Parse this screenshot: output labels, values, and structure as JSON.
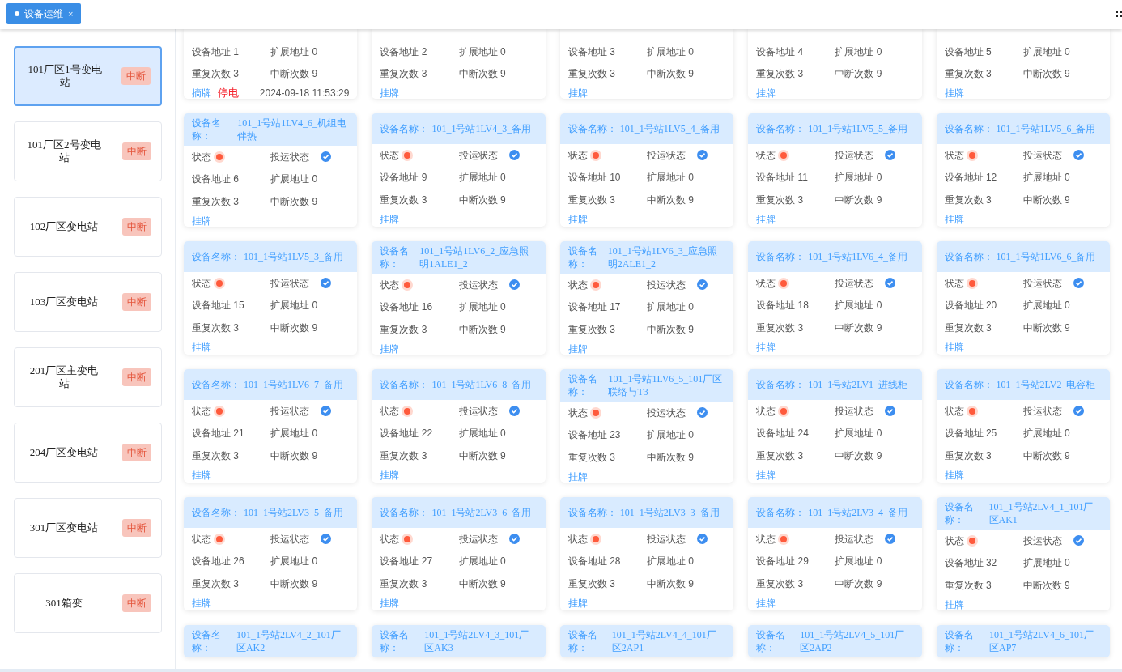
{
  "tabs": [
    {
      "label": "设备运维",
      "selected": true,
      "close": "×"
    }
  ],
  "stations": [
    {
      "name": "101厂区1号变电站",
      "badge": "中断",
      "selected": true
    },
    {
      "name": "101厂区2号变电站",
      "badge": "中断",
      "selected": false
    },
    {
      "name": "102厂区变电站",
      "badge": "中断",
      "selected": false
    },
    {
      "name": "103厂区变电站",
      "badge": "中断",
      "selected": false
    },
    {
      "name": "201厂区主变电站",
      "badge": "中断",
      "selected": false
    },
    {
      "name": "204厂区变电站",
      "badge": "中断",
      "selected": false
    },
    {
      "name": "301厂区变电站",
      "badge": "中断",
      "selected": false
    },
    {
      "name": "301箱变",
      "badge": "中断",
      "selected": false
    }
  ],
  "devices": [
    {
      "kind": "partial-top",
      "address": "设备地址 1",
      "ext": "扩展地址 0",
      "repeat": "重复次数 3",
      "breaks": "中断次数 9",
      "actions": [
        {
          "kind": "link",
          "text": "摘牌"
        },
        {
          "kind": "alert",
          "text": "停电"
        },
        {
          "kind": "time",
          "text": "2024-09-18 11:53:29"
        }
      ]
    },
    {
      "kind": "partial-top",
      "address": "设备地址 2",
      "ext": "扩展地址 0",
      "repeat": "重复次数 3",
      "breaks": "中断次数 9",
      "actions": [
        {
          "kind": "link",
          "text": "挂牌"
        }
      ]
    },
    {
      "kind": "partial-top",
      "address": "设备地址 3",
      "ext": "扩展地址 0",
      "repeat": "重复次数 3",
      "breaks": "中断次数 9",
      "actions": [
        {
          "kind": "link",
          "text": "挂牌"
        }
      ]
    },
    {
      "kind": "partial-top",
      "address": "设备地址 4",
      "ext": "扩展地址 0",
      "repeat": "重复次数 3",
      "breaks": "中断次数 9",
      "actions": [
        {
          "kind": "link",
          "text": "挂牌"
        }
      ]
    },
    {
      "kind": "partial-top",
      "address": "设备地址 5",
      "ext": "扩展地址 0",
      "repeat": "重复次数 3",
      "breaks": "中断次数 9",
      "actions": [
        {
          "kind": "link",
          "text": "挂牌"
        }
      ]
    },
    {
      "kind": "full",
      "name_label": "设备名称：",
      "name": "101_1号站1LV4_6_机组电伴热",
      "status_label": "状态",
      "alarm": true,
      "run_label": "投运状态",
      "in_service": true,
      "address": "设备地址 6",
      "ext": "扩展地址 0",
      "repeat": "重复次数 3",
      "breaks": "中断次数 9",
      "actions": [
        {
          "kind": "link",
          "text": "挂牌"
        }
      ]
    },
    {
      "kind": "full",
      "name_label": "设备名称：",
      "name": "101_1号站1LV4_3_备用",
      "status_label": "状态",
      "alarm": true,
      "run_label": "投运状态",
      "in_service": true,
      "address": "设备地址 9",
      "ext": "扩展地址 0",
      "repeat": "重复次数 3",
      "breaks": "中断次数 9",
      "actions": [
        {
          "kind": "link",
          "text": "挂牌"
        }
      ]
    },
    {
      "kind": "full",
      "name_label": "设备名称：",
      "name": "101_1号站1LV5_4_备用",
      "status_label": "状态",
      "alarm": true,
      "run_label": "投运状态",
      "in_service": true,
      "address": "设备地址 10",
      "ext": "扩展地址 0",
      "repeat": "重复次数 3",
      "breaks": "中断次数 9",
      "actions": [
        {
          "kind": "link",
          "text": "挂牌"
        }
      ]
    },
    {
      "kind": "full",
      "name_label": "设备名称：",
      "name": "101_1号站1LV5_5_备用",
      "status_label": "状态",
      "alarm": true,
      "run_label": "投运状态",
      "in_service": true,
      "address": "设备地址 11",
      "ext": "扩展地址 0",
      "repeat": "重复次数 3",
      "breaks": "中断次数 9",
      "actions": [
        {
          "kind": "link",
          "text": "挂牌"
        }
      ]
    },
    {
      "kind": "full",
      "name_label": "设备名称：",
      "name": "101_1号站1LV5_6_备用",
      "status_label": "状态",
      "alarm": true,
      "run_label": "投运状态",
      "in_service": true,
      "address": "设备地址 12",
      "ext": "扩展地址 0",
      "repeat": "重复次数 3",
      "breaks": "中断次数 9",
      "actions": [
        {
          "kind": "link",
          "text": "挂牌"
        }
      ]
    },
    {
      "kind": "full",
      "name_label": "设备名称：",
      "name": "101_1号站1LV5_3_备用",
      "status_label": "状态",
      "alarm": true,
      "run_label": "投运状态",
      "in_service": true,
      "address": "设备地址 15",
      "ext": "扩展地址 0",
      "repeat": "重复次数 3",
      "breaks": "中断次数 9",
      "actions": [
        {
          "kind": "link",
          "text": "挂牌"
        }
      ]
    },
    {
      "kind": "full",
      "name_label": "设备名称：",
      "name": "101_1号站1LV6_2_应急照明1ALE1_2",
      "status_label": "状态",
      "alarm": true,
      "run_label": "投运状态",
      "in_service": true,
      "address": "设备地址 16",
      "ext": "扩展地址 0",
      "repeat": "重复次数 3",
      "breaks": "中断次数 9",
      "actions": [
        {
          "kind": "link",
          "text": "挂牌"
        }
      ]
    },
    {
      "kind": "full",
      "name_label": "设备名称：",
      "name": "101_1号站1LV6_3_应急照明2ALE1_2",
      "status_label": "状态",
      "alarm": true,
      "run_label": "投运状态",
      "in_service": true,
      "address": "设备地址 17",
      "ext": "扩展地址 0",
      "repeat": "重复次数 3",
      "breaks": "中断次数 9",
      "actions": [
        {
          "kind": "link",
          "text": "挂牌"
        }
      ]
    },
    {
      "kind": "full",
      "name_label": "设备名称：",
      "name": "101_1号站1LV6_4_备用",
      "status_label": "状态",
      "alarm": true,
      "run_label": "投运状态",
      "in_service": true,
      "address": "设备地址 18",
      "ext": "扩展地址 0",
      "repeat": "重复次数 3",
      "breaks": "中断次数 9",
      "actions": [
        {
          "kind": "link",
          "text": "挂牌"
        }
      ]
    },
    {
      "kind": "full",
      "name_label": "设备名称：",
      "name": "101_1号站1LV6_6_备用",
      "status_label": "状态",
      "alarm": true,
      "run_label": "投运状态",
      "in_service": true,
      "address": "设备地址 20",
      "ext": "扩展地址 0",
      "repeat": "重复次数 3",
      "breaks": "中断次数 9",
      "actions": [
        {
          "kind": "link",
          "text": "挂牌"
        }
      ]
    },
    {
      "kind": "full",
      "name_label": "设备名称：",
      "name": "101_1号站1LV6_7_备用",
      "status_label": "状态",
      "alarm": true,
      "run_label": "投运状态",
      "in_service": true,
      "address": "设备地址 21",
      "ext": "扩展地址 0",
      "repeat": "重复次数 3",
      "breaks": "中断次数 9",
      "actions": [
        {
          "kind": "link",
          "text": "挂牌"
        }
      ]
    },
    {
      "kind": "full",
      "name_label": "设备名称：",
      "name": "101_1号站1LV6_8_备用",
      "status_label": "状态",
      "alarm": true,
      "run_label": "投运状态",
      "in_service": true,
      "address": "设备地址 22",
      "ext": "扩展地址 0",
      "repeat": "重复次数 3",
      "breaks": "中断次数 9",
      "actions": [
        {
          "kind": "link",
          "text": "挂牌"
        }
      ]
    },
    {
      "kind": "full",
      "name_label": "设备名称：",
      "name": "101_1号站1LV6_5_101厂区联络与T3",
      "status_label": "状态",
      "alarm": true,
      "run_label": "投运状态",
      "in_service": true,
      "address": "设备地址 23",
      "ext": "扩展地址 0",
      "repeat": "重复次数 3",
      "breaks": "中断次数 9",
      "actions": [
        {
          "kind": "link",
          "text": "挂牌"
        }
      ]
    },
    {
      "kind": "full",
      "name_label": "设备名称：",
      "name": "101_1号站2LV1_进线柜",
      "status_label": "状态",
      "alarm": true,
      "run_label": "投运状态",
      "in_service": true,
      "address": "设备地址 24",
      "ext": "扩展地址 0",
      "repeat": "重复次数 3",
      "breaks": "中断次数 9",
      "actions": [
        {
          "kind": "link",
          "text": "挂牌"
        }
      ]
    },
    {
      "kind": "full",
      "name_label": "设备名称：",
      "name": "101_1号站2LV2_电容柜",
      "status_label": "状态",
      "alarm": true,
      "run_label": "投运状态",
      "in_service": true,
      "address": "设备地址 25",
      "ext": "扩展地址 0",
      "repeat": "重复次数 3",
      "breaks": "中断次数 9",
      "actions": [
        {
          "kind": "link",
          "text": "挂牌"
        }
      ]
    },
    {
      "kind": "full",
      "name_label": "设备名称：",
      "name": "101_1号站2LV3_5_备用",
      "status_label": "状态",
      "alarm": true,
      "run_label": "投运状态",
      "in_service": true,
      "address": "设备地址 26",
      "ext": "扩展地址 0",
      "repeat": "重复次数 3",
      "breaks": "中断次数 9",
      "actions": [
        {
          "kind": "link",
          "text": "挂牌"
        }
      ]
    },
    {
      "kind": "full",
      "name_label": "设备名称：",
      "name": "101_1号站2LV3_6_备用",
      "status_label": "状态",
      "alarm": true,
      "run_label": "投运状态",
      "in_service": true,
      "address": "设备地址 27",
      "ext": "扩展地址 0",
      "repeat": "重复次数 3",
      "breaks": "中断次数 9",
      "actions": [
        {
          "kind": "link",
          "text": "挂牌"
        }
      ]
    },
    {
      "kind": "full",
      "name_label": "设备名称：",
      "name": "101_1号站2LV3_3_备用",
      "status_label": "状态",
      "alarm": true,
      "run_label": "投运状态",
      "in_service": true,
      "address": "设备地址 28",
      "ext": "扩展地址 0",
      "repeat": "重复次数 3",
      "breaks": "中断次数 9",
      "actions": [
        {
          "kind": "link",
          "text": "挂牌"
        }
      ]
    },
    {
      "kind": "full",
      "name_label": "设备名称：",
      "name": "101_1号站2LV3_4_备用",
      "status_label": "状态",
      "alarm": true,
      "run_label": "投运状态",
      "in_service": true,
      "address": "设备地址 29",
      "ext": "扩展地址 0",
      "repeat": "重复次数 3",
      "breaks": "中断次数 9",
      "actions": [
        {
          "kind": "link",
          "text": "挂牌"
        }
      ]
    },
    {
      "kind": "full",
      "name_label": "设备名称：",
      "name": "101_1号站2LV4_1_101厂区AK1",
      "status_label": "状态",
      "alarm": true,
      "run_label": "投运状态",
      "in_service": true,
      "address": "设备地址 32",
      "ext": "扩展地址 0",
      "repeat": "重复次数 3",
      "breaks": "中断次数 9",
      "actions": [
        {
          "kind": "link",
          "text": "挂牌"
        }
      ]
    },
    {
      "kind": "partial-bottom",
      "name_label": "设备名称：",
      "name": "101_1号站2LV4_2_101厂区AK2"
    },
    {
      "kind": "partial-bottom",
      "name_label": "设备名称：",
      "name": "101_1号站2LV4_3_101厂区AK3"
    },
    {
      "kind": "partial-bottom",
      "name_label": "设备名称：",
      "name": "101_1号站2LV4_4_101厂区2AP1"
    },
    {
      "kind": "partial-bottom",
      "name_label": "设备名称：",
      "name": "101_1号站2LV4_5_101厂区2AP2"
    },
    {
      "kind": "partial-bottom",
      "name_label": "设备名称：",
      "name": "101_1号站2LV4_6_101厂区AP7"
    }
  ]
}
